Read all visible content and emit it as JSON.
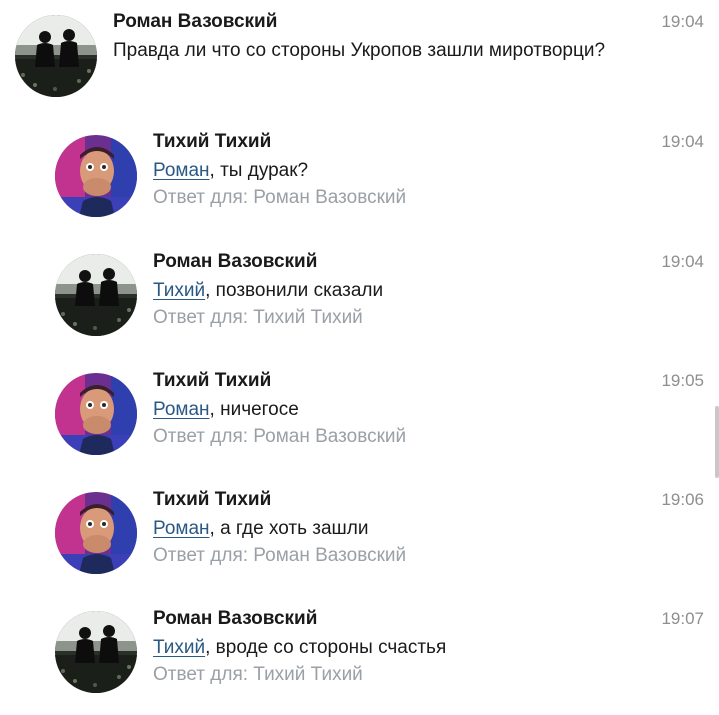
{
  "comments": [
    {
      "author": "Роман Вазовский",
      "avatar": "photo-pair-avatar",
      "time": "19:04",
      "mention": "",
      "text": "Правда ли что со стороны Укропов зашли миротворци?",
      "reply": ""
    },
    {
      "author": "Тихий Тихий",
      "avatar": "selfie-avatar",
      "time": "19:04",
      "mention": "Роман",
      "text": ", ты дурак?",
      "reply": "Ответ для: Роман Вазовский"
    },
    {
      "author": "Роман Вазовский",
      "avatar": "photo-pair-avatar",
      "time": "19:04",
      "mention": "Тихий",
      "text": ", позвонили сказали",
      "reply": "Ответ для: Тихий Тихий"
    },
    {
      "author": "Тихий Тихий",
      "avatar": "selfie-avatar",
      "time": "19:05",
      "mention": "Роман",
      "text": ", ничегосе",
      "reply": "Ответ для: Роман Вазовский"
    },
    {
      "author": "Тихий Тихий",
      "avatar": "selfie-avatar",
      "time": "19:06",
      "mention": "Роман",
      "text": ", а где хоть зашли",
      "reply": "Ответ для: Роман Вазовский"
    },
    {
      "author": "Роман Вазовский",
      "avatar": "photo-pair-avatar",
      "time": "19:07",
      "mention": "Тихий",
      "text": ", вроде со стороны счастья",
      "reply": "Ответ для: Тихий Тихий"
    }
  ],
  "colors": {
    "mention": "#2a5885",
    "reply": "#9aa0a6",
    "time": "#8e8e8e"
  }
}
